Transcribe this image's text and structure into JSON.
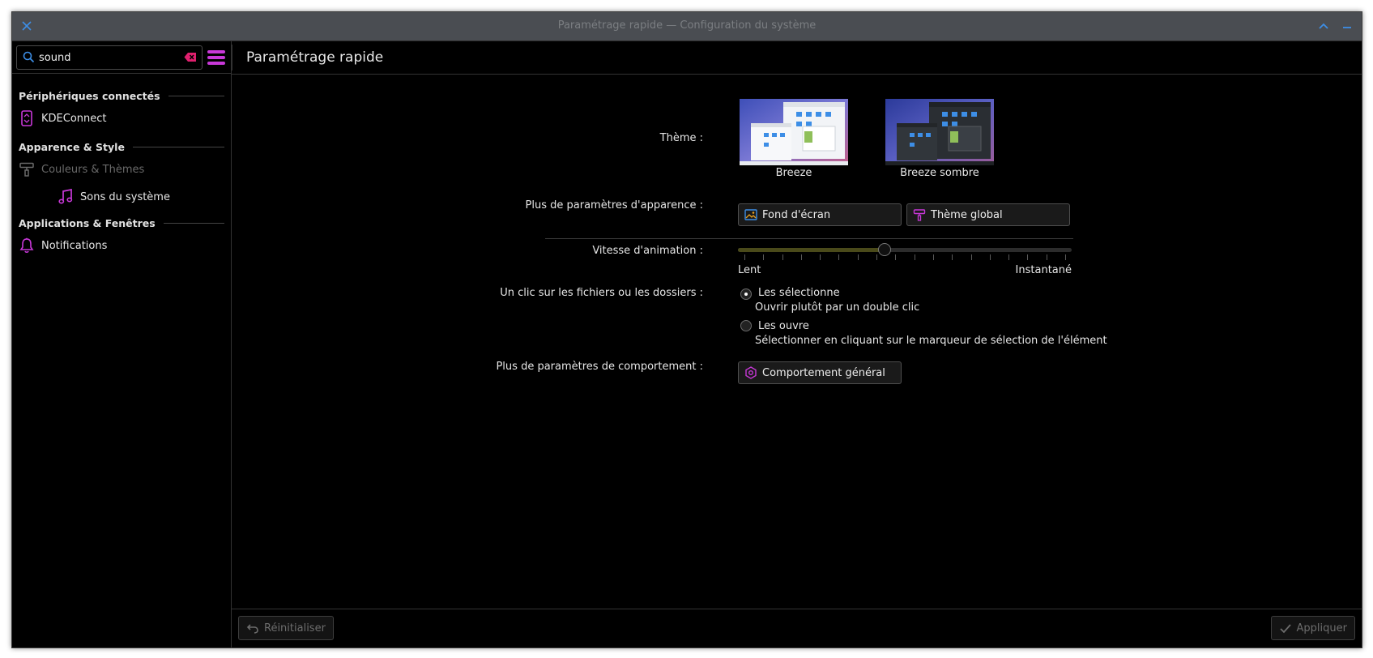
{
  "window": {
    "title": "Paramétrage rapide — Configuration du système"
  },
  "titlebar": {
    "close_icon": "close-icon",
    "keep_above_icon": "chevron-up-icon",
    "minimize_icon": "minimize-icon",
    "accent": "#3d8ee6"
  },
  "sidebar": {
    "search": {
      "value": "sound",
      "placeholder": ""
    },
    "categories": [
      {
        "label": "Périphériques connectés",
        "items": [
          {
            "label": "KDEConnect",
            "icon": "kdeconnect-icon"
          }
        ]
      },
      {
        "label": "Apparence & Style",
        "items": [
          {
            "label": "Couleurs & Thèmes",
            "icon": "paint-roller-icon",
            "disabled": true
          },
          {
            "label": "Sons du système",
            "icon": "music-note-icon"
          }
        ]
      },
      {
        "label": "Applications & Fenêtres",
        "items": [
          {
            "label": "Notifications",
            "icon": "bell-icon"
          }
        ]
      }
    ],
    "icon_color": "#c838d8"
  },
  "header": {
    "title": "Paramétrage rapide"
  },
  "settings": {
    "theme": {
      "label": "Thème :",
      "options": [
        {
          "name": "Breeze",
          "selected": false
        },
        {
          "name": "Breeze sombre",
          "selected": false
        }
      ]
    },
    "appearance": {
      "label": "Plus de paramètres d'apparence :",
      "wallpaper_button": "Fond d'écran",
      "global_theme_button": "Thème global"
    },
    "animation": {
      "label": "Vitesse d'animation :",
      "min_label": "Lent",
      "max_label": "Instantané",
      "value": 0.44,
      "ticks": 18
    },
    "click": {
      "label": "Un clic sur les fichiers ou les dossiers :",
      "options": [
        {
          "title": "Les sélectionne",
          "subtitle": "Ouvrir plutôt par un double clic",
          "checked": true
        },
        {
          "title": "Les ouvre",
          "subtitle": "Sélectionner en cliquant sur le marqueur de sélection de l'élément",
          "checked": false
        }
      ]
    },
    "behavior": {
      "label": "Plus de paramètres de comportement :",
      "general_button": "Comportement général"
    }
  },
  "footer": {
    "reset_button": "Réinitialiser",
    "apply_button": "Appliquer"
  }
}
